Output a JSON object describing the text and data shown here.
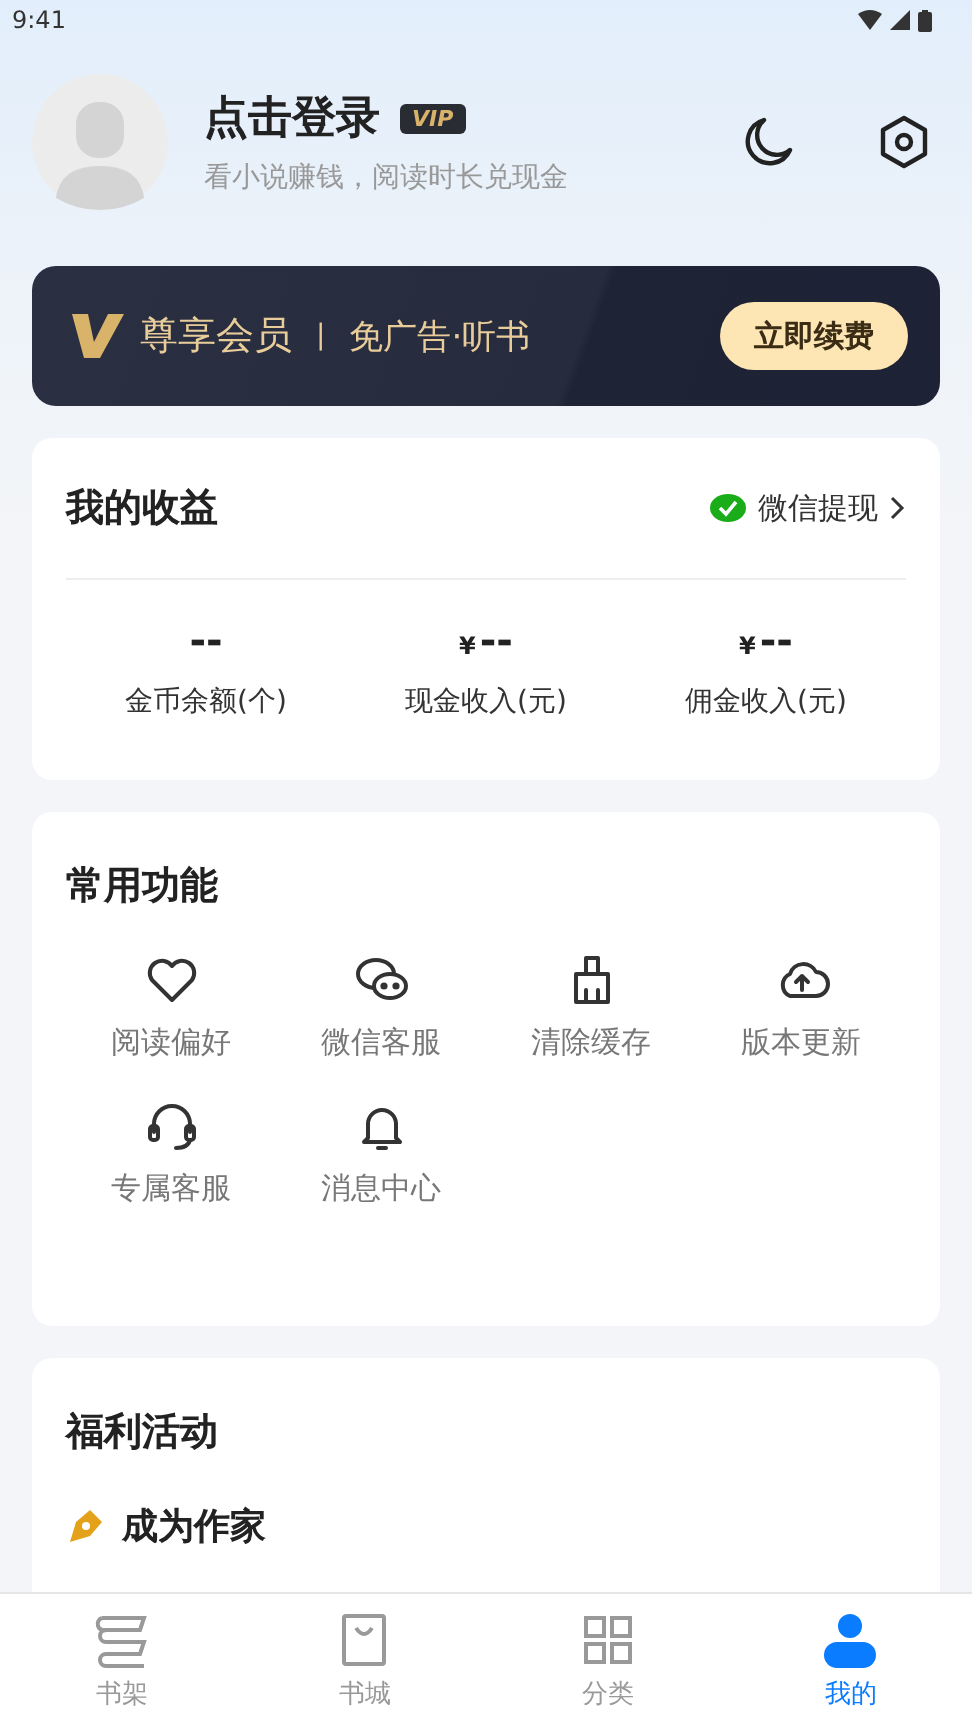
{
  "status_bar": {
    "time": "9:41"
  },
  "profile": {
    "name": "点击登录",
    "badge": "VIP",
    "subtitle": "看小说赚钱，阅读时长兑现金"
  },
  "vip_banner": {
    "title": "尊享会员",
    "separator": "|",
    "perks": "免广告·听书",
    "button": "立即续费"
  },
  "earnings": {
    "title": "我的收益",
    "withdraw": "微信提现",
    "items": [
      {
        "value": "--",
        "label": "金币余额(个)",
        "currency": false
      },
      {
        "value": "--",
        "label": "现金收入(元)",
        "currency": true
      },
      {
        "value": "--",
        "label": "佣金收入(元)",
        "currency": true
      }
    ],
    "currency_symbol": "¥"
  },
  "functions": {
    "title": "常用功能",
    "items": [
      {
        "label": "阅读偏好",
        "kind": "heart"
      },
      {
        "label": "微信客服",
        "kind": "wechat"
      },
      {
        "label": "清除缓存",
        "kind": "broom"
      },
      {
        "label": "版本更新",
        "kind": "upload"
      },
      {
        "label": "专属客服",
        "kind": "headset"
      },
      {
        "label": "消息中心",
        "kind": "bell"
      }
    ]
  },
  "welfare": {
    "title": "福利活动",
    "items": [
      {
        "label": "成为作家"
      }
    ]
  },
  "tabs": [
    {
      "label": "书架",
      "kind": "shelf",
      "selected": false
    },
    {
      "label": "书城",
      "kind": "bag",
      "selected": false
    },
    {
      "label": "分类",
      "kind": "grid",
      "selected": false
    },
    {
      "label": "我的",
      "kind": "person",
      "selected": true
    }
  ]
}
